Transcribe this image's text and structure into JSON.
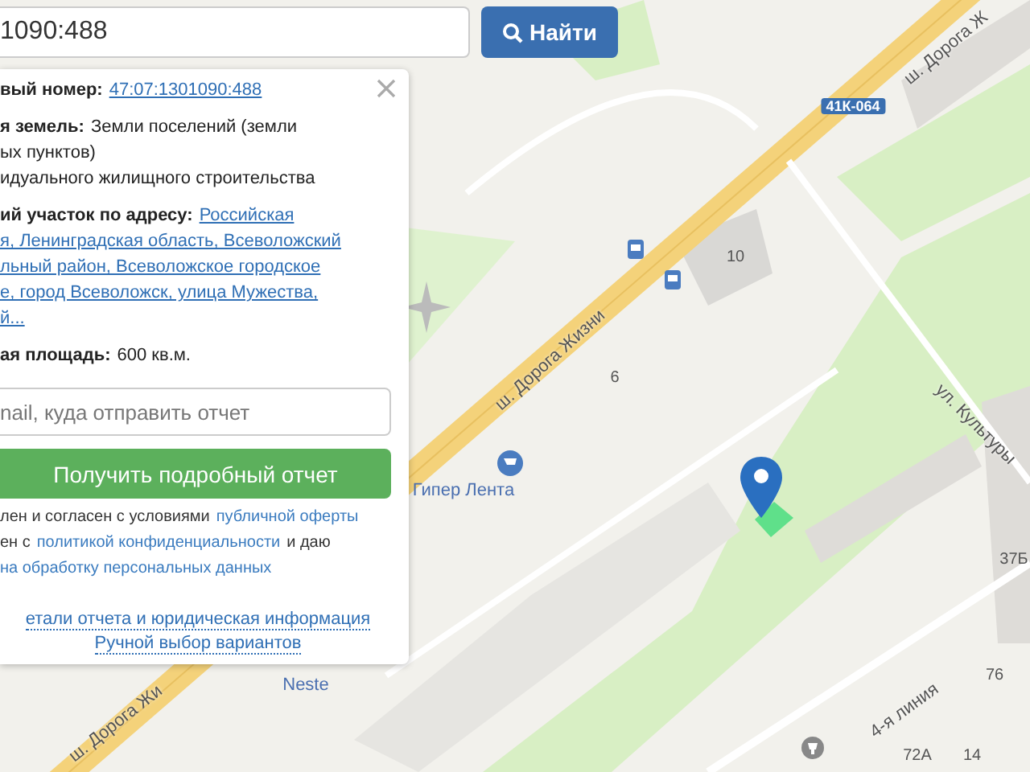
{
  "search": {
    "value": "1090:488",
    "button": "Найти"
  },
  "panel": {
    "blocks": [
      {
        "rows": [
          [
            {
              "kind": "label",
              "text": "вый номер:"
            },
            {
              "kind": "link",
              "text": "47:07:1301090:488"
            }
          ]
        ]
      },
      {
        "rows": [
          [
            {
              "kind": "label",
              "text": "я земель:"
            },
            {
              "kind": "text",
              "text": "Земли поселений (земли"
            }
          ],
          [
            {
              "kind": "text",
              "text": "ых пунктов)"
            }
          ],
          [
            {
              "kind": "text",
              "text": "идуального жилищного строительства"
            }
          ]
        ]
      },
      {
        "rows": [
          [
            {
              "kind": "label",
              "text": "ий участок по адресу:"
            },
            {
              "kind": "link",
              "text": "Российская"
            }
          ],
          [
            {
              "kind": "link",
              "text": "я, Ленинградская область, Всеволожский"
            }
          ],
          [
            {
              "kind": "link",
              "text": "льный район, Всеволожское городское"
            }
          ],
          [
            {
              "kind": "link",
              "text": "е, город Всеволожск, улица Мужества,"
            }
          ],
          [
            {
              "kind": "link",
              "text": "й..."
            }
          ]
        ]
      },
      {
        "rows": [
          [
            {
              "kind": "label",
              "text": "ая площадь:"
            },
            {
              "kind": "text",
              "text": "600 кв.м."
            }
          ]
        ]
      }
    ],
    "email": {
      "placeholder": "nail, куда отправить отчет"
    },
    "submit": "Получить подробный отчет",
    "consent": [
      [
        {
          "kind": "text",
          "text": "лен и согласен с условиями"
        },
        {
          "kind": "link",
          "text": "публичной оферты"
        }
      ],
      [
        {
          "kind": "text",
          "text": "ен с"
        },
        {
          "kind": "link",
          "text": "политикой конфиденциальности"
        },
        {
          "kind": "text",
          "text": "и даю"
        }
      ],
      [
        {
          "kind": "link",
          "text": "на обработку персональных данных"
        }
      ]
    ],
    "links": [
      "етали отчета и юридическая информация",
      "Ручной выбор вариантов"
    ]
  },
  "map": {
    "labels": [
      {
        "kind": "road",
        "text": "ш. Дорога Жизни"
      },
      {
        "kind": "road",
        "text": "ш. Дорога Ж"
      },
      {
        "kind": "badge",
        "text": "41К-064"
      },
      {
        "kind": "number",
        "text": "10"
      },
      {
        "kind": "number",
        "text": "6"
      },
      {
        "kind": "place",
        "text": "Гипер Лента"
      },
      {
        "kind": "road",
        "text": "ул. Культуры"
      },
      {
        "kind": "number",
        "text": "37Б"
      },
      {
        "kind": "place",
        "text": "Neste"
      },
      {
        "kind": "road",
        "text": "ш. Дорога Жи"
      },
      {
        "kind": "number",
        "text": "76"
      },
      {
        "kind": "road",
        "text": "4-я линия"
      },
      {
        "kind": "number",
        "text": "72А"
      },
      {
        "kind": "number",
        "text": "14"
      }
    ]
  }
}
